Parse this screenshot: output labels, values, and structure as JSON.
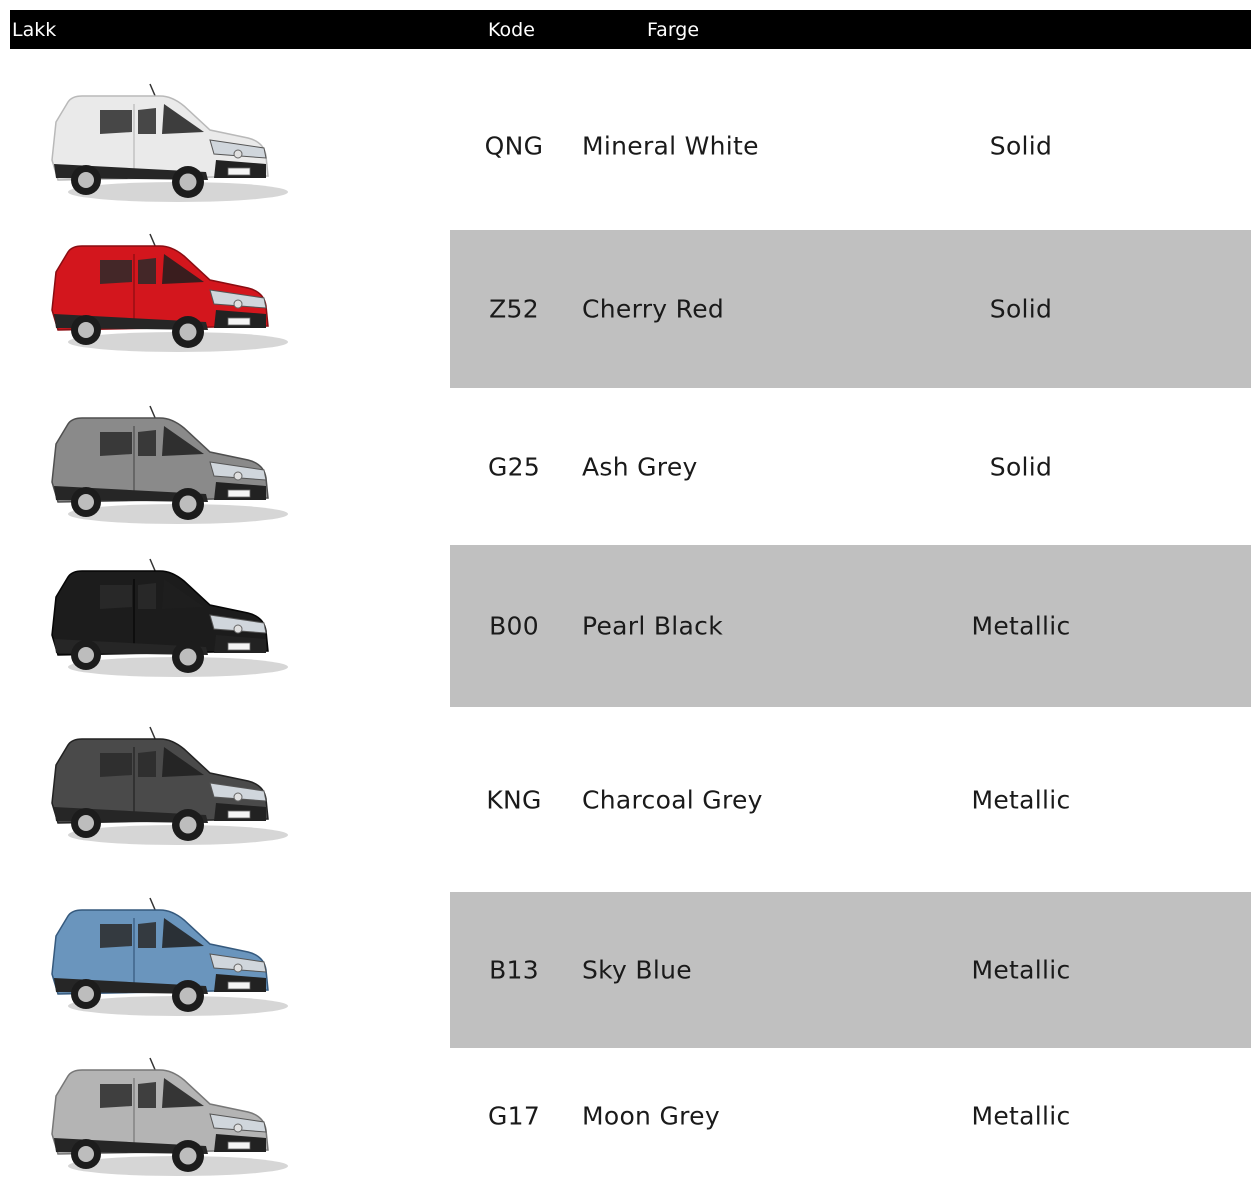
{
  "header": {
    "lakk": "Lakk",
    "kode": "Kode",
    "farge": "Farge"
  },
  "rows": [
    {
      "code": "QNG",
      "name": "Mineral White",
      "type": "Solid",
      "body": "#eaeaea",
      "shade": "#b9b9b9",
      "shaded": false
    },
    {
      "code": "Z52",
      "name": "Cherry Red",
      "type": "Solid",
      "body": "#d3161d",
      "shade": "#8a0d12",
      "shaded": true
    },
    {
      "code": "G25",
      "name": "Ash Grey",
      "type": "Solid",
      "body": "#8a8a8a",
      "shade": "#4f4f4f",
      "shaded": false
    },
    {
      "code": "B00",
      "name": "Pearl Black",
      "type": "Metallic",
      "body": "#1c1c1c",
      "shade": "#050505",
      "shaded": true
    },
    {
      "code": "KNG",
      "name": "Charcoal Grey",
      "type": "Metallic",
      "body": "#4a4a4a",
      "shade": "#222222",
      "shaded": false
    },
    {
      "code": "B13",
      "name": "Sky Blue",
      "type": "Metallic",
      "body": "#6a95bd",
      "shade": "#35597d",
      "shaded": true
    },
    {
      "code": "G17",
      "name": "Moon Grey",
      "type": "Metallic",
      "body": "#b4b4b4",
      "shade": "#777777",
      "shaded": false
    }
  ]
}
